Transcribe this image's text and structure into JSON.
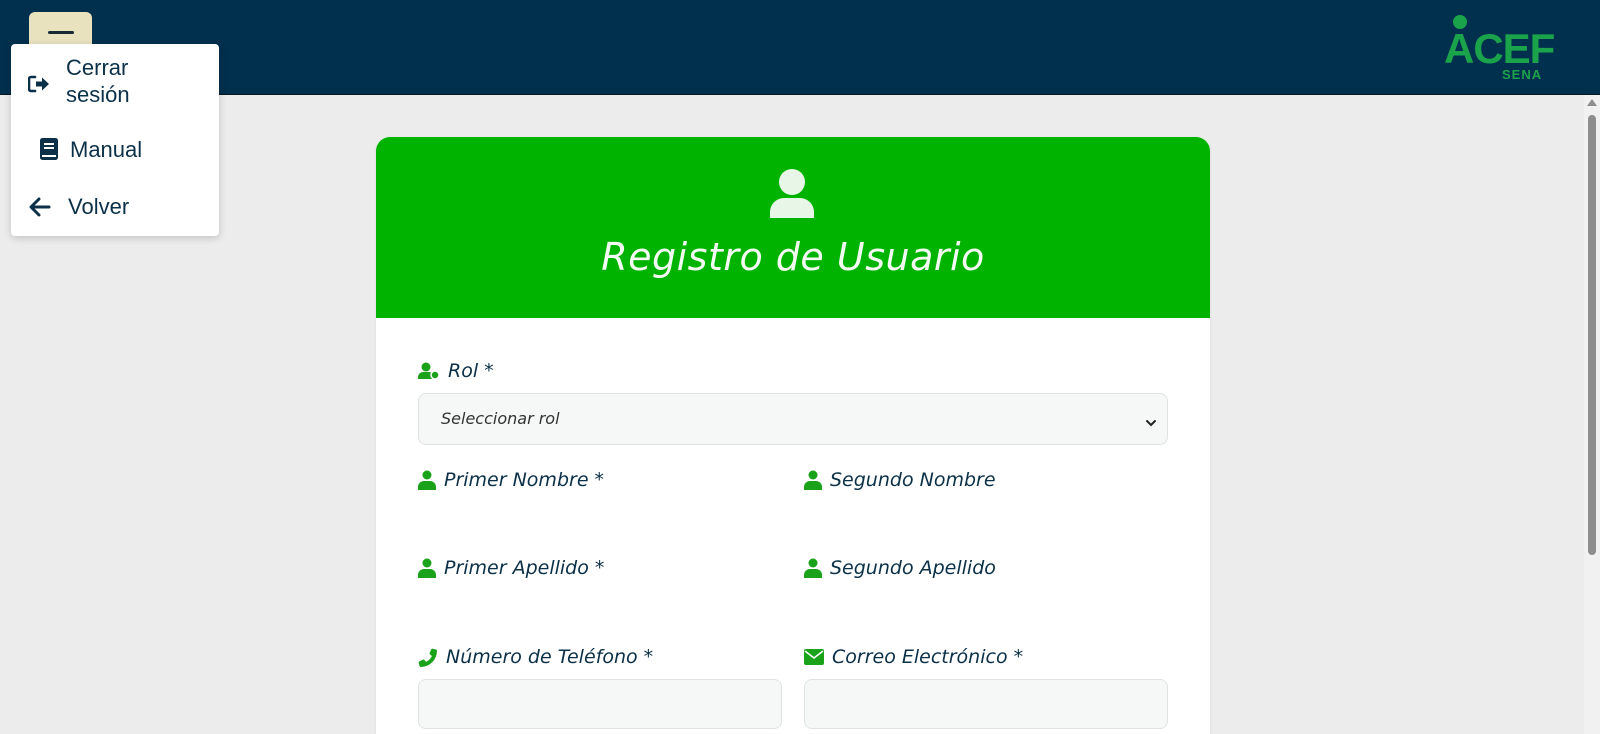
{
  "header": {
    "menu_button": "menu",
    "logo": {
      "word": "ACEF",
      "sub": "SENA",
      "color": "#1aa34a"
    }
  },
  "dropdown": {
    "items": [
      {
        "label_line1": "Cerrar",
        "label_line2": "sesión",
        "icon": "logout-icon"
      },
      {
        "label": "Manual",
        "icon": "book-icon"
      },
      {
        "label": "Volver",
        "icon": "arrow-left-icon"
      }
    ]
  },
  "form": {
    "title": "Registro de Usuario",
    "accent": "#00b300",
    "fields": {
      "rol": {
        "label": "Rol *",
        "placeholder": "Seleccionar rol"
      },
      "primer_nombre": {
        "label": "Primer Nombre *"
      },
      "segundo_nombre": {
        "label": "Segundo Nombre"
      },
      "primer_apellido": {
        "label": "Primer Apellido *"
      },
      "segundo_apellido": {
        "label": "Segundo Apellido"
      },
      "telefono": {
        "label": "Número de Teléfono *"
      },
      "correo": {
        "label": "Correo Electrónico *"
      }
    }
  }
}
